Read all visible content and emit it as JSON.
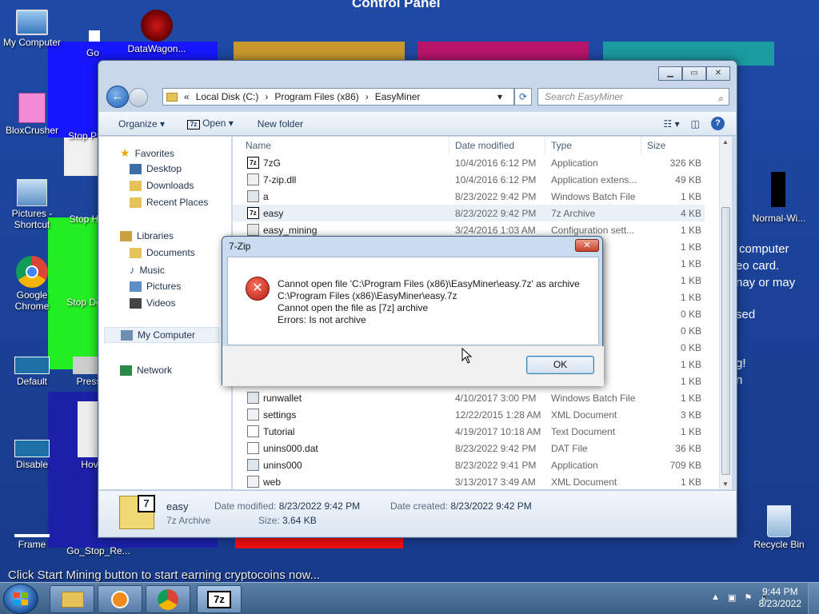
{
  "desktop": {
    "control_panel_title": "Control Panel",
    "icons": [
      {
        "label": "My Computer"
      },
      {
        "label": "Go"
      },
      {
        "label": "DataWagon..."
      },
      {
        "label": "BloxCrusher"
      },
      {
        "label": "Stop Pr"
      },
      {
        "label": "Pictures - Shortcut"
      },
      {
        "label": "Stop H"
      },
      {
        "label": "Google Chrome"
      },
      {
        "label": "Stop De"
      },
      {
        "label": "Default"
      },
      {
        "label": "Press"
      },
      {
        "label": "Disable"
      },
      {
        "label": "Hov"
      },
      {
        "label": "Frame"
      },
      {
        "label": "Go_Stop_Re..."
      },
      {
        "label": "Normal-Wi..."
      },
      {
        "label": "Recycle Bin"
      }
    ],
    "background_text": [
      "computer",
      "eo card.",
      "nay or may",
      "sed",
      "g!",
      "n"
    ],
    "tip": "Click Start Mining button to start earning cryptocoins now..."
  },
  "explorer": {
    "address": [
      "Local Disk (C:)",
      "Program Files (x86)",
      "EasyMiner"
    ],
    "address_prefix": "«",
    "search_placeholder": "Search EasyMiner",
    "toolbar": {
      "organize": "Organize ▾",
      "open": "Open ▾",
      "new_folder": "New folder"
    },
    "nav": {
      "favorites": "Favorites",
      "desktop": "Desktop",
      "downloads": "Downloads",
      "recent": "Recent Places",
      "libraries": "Libraries",
      "documents": "Documents",
      "music": "Music",
      "pictures": "Pictures",
      "videos": "Videos",
      "my_computer": "My Computer",
      "network": "Network"
    },
    "columns": {
      "name": "Name",
      "date": "Date modified",
      "type": "Type",
      "size": "Size"
    },
    "files": [
      {
        "name": "7zG",
        "date": "10/4/2016 6:12 PM",
        "type": "Application",
        "size": "326 KB",
        "icon": "7z"
      },
      {
        "name": "7-zip.dll",
        "date": "10/4/2016 6:12 PM",
        "type": "Application extens...",
        "size": "49 KB",
        "icon": "dll"
      },
      {
        "name": "a",
        "date": "8/23/2022 9:42 PM",
        "type": "Windows Batch File",
        "size": "1 KB",
        "icon": "bat"
      },
      {
        "name": "easy",
        "date": "8/23/2022 9:42 PM",
        "type": "7z Archive",
        "size": "4 KB",
        "icon": "7z"
      },
      {
        "name": "easy_mining",
        "date": "3/24/2016 1:03 AM",
        "type": "Configuration sett...",
        "size": "1 KB",
        "icon": "cfg"
      },
      {
        "name": "",
        "date": "",
        "type": "sett...",
        "size": "1 KB",
        "icon": ""
      },
      {
        "name": "",
        "date": "",
        "type": "ch File",
        "size": "1 KB",
        "icon": ""
      },
      {
        "name": "",
        "date": "",
        "type": "sett...",
        "size": "1 KB",
        "icon": ""
      },
      {
        "name": "",
        "date": "",
        "type": "nt",
        "size": "1 KB",
        "icon": ""
      },
      {
        "name": "",
        "date": "",
        "type": "",
        "size": "0 KB",
        "icon": ""
      },
      {
        "name": "",
        "date": "",
        "type": "",
        "size": "0 KB",
        "icon": ""
      },
      {
        "name": "",
        "date": "",
        "type": "",
        "size": "0 KB",
        "icon": ""
      },
      {
        "name": "",
        "date": "",
        "type": "",
        "size": "1 KB",
        "icon": ""
      },
      {
        "name": "",
        "date": "",
        "type": "ch File",
        "size": "1 KB",
        "icon": ""
      },
      {
        "name": "runwallet",
        "date": "4/10/2017 3:00 PM",
        "type": "Windows Batch File",
        "size": "1 KB",
        "icon": "bat"
      },
      {
        "name": "settings",
        "date": "12/22/2015 1:28 AM",
        "type": "XML Document",
        "size": "3 KB",
        "icon": "xml"
      },
      {
        "name": "Tutorial",
        "date": "4/19/2017 10:18 AM",
        "type": "Text Document",
        "size": "1 KB",
        "icon": "txt"
      },
      {
        "name": "unins000.dat",
        "date": "8/23/2022 9:42 PM",
        "type": "DAT File",
        "size": "36 KB",
        "icon": "dat"
      },
      {
        "name": "unins000",
        "date": "8/23/2022 9:41 PM",
        "type": "Application",
        "size": "709 KB",
        "icon": "exe"
      },
      {
        "name": "web",
        "date": "3/13/2017 3:49 AM",
        "type": "XML Document",
        "size": "1 KB",
        "icon": "xml"
      }
    ],
    "details": {
      "name": "easy",
      "type": "7z Archive",
      "modified_label": "Date modified:",
      "modified": "8/23/2022 9:42 PM",
      "created_label": "Date created:",
      "created": "8/23/2022 9:42 PM",
      "size_label": "Size:",
      "size": "3.64 KB"
    }
  },
  "dialog": {
    "title": "7-Zip",
    "lines": [
      "Cannot open file 'C:\\Program Files (x86)\\EasyMiner\\easy.7z' as archive",
      "C:\\Program Files (x86)\\EasyMiner\\easy.7z",
      "Cannot open the file as [7z] archive",
      "Errors: Is not archive"
    ],
    "ok": "OK"
  },
  "taskbar": {
    "time": "9:44 PM",
    "date": "8/23/2022"
  }
}
